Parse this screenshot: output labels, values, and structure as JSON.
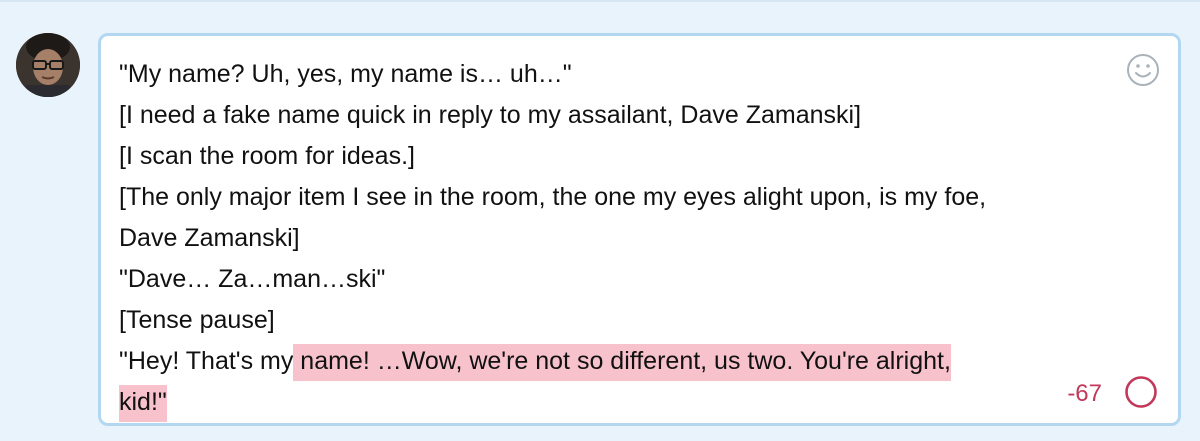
{
  "composer": {
    "lines": [
      "\"My name? Uh, yes, my name is… uh…\"",
      "[I need a fake name quick in reply to my assailant, Dave Zamanski]",
      "[I scan the room for ideas.]",
      "[The only major item I see in the room, the one my eyes alight upon, is my foe,",
      "Dave Zamanski]",
      "\"Dave… Za…man…ski\"",
      "[Tense pause]"
    ],
    "last_line_normal": "\"Hey! That's my",
    "last_line_overflow": " name! …Wow, we're not so different, us two. You're alright,",
    "final_line_overflow": "kid!\"",
    "remaining_characters": "-67",
    "remaining_fraction": 0
  },
  "colors": {
    "background": "#e8f3fc",
    "box_border": "#b3d7f1",
    "overflow_highlight": "#f7c2cc",
    "counter_red": "#c2385a",
    "emoji_icon_gray": "#aab2ba"
  },
  "icons": {
    "emoji": "smiley-face-icon",
    "progress": "progress-ring-icon"
  }
}
